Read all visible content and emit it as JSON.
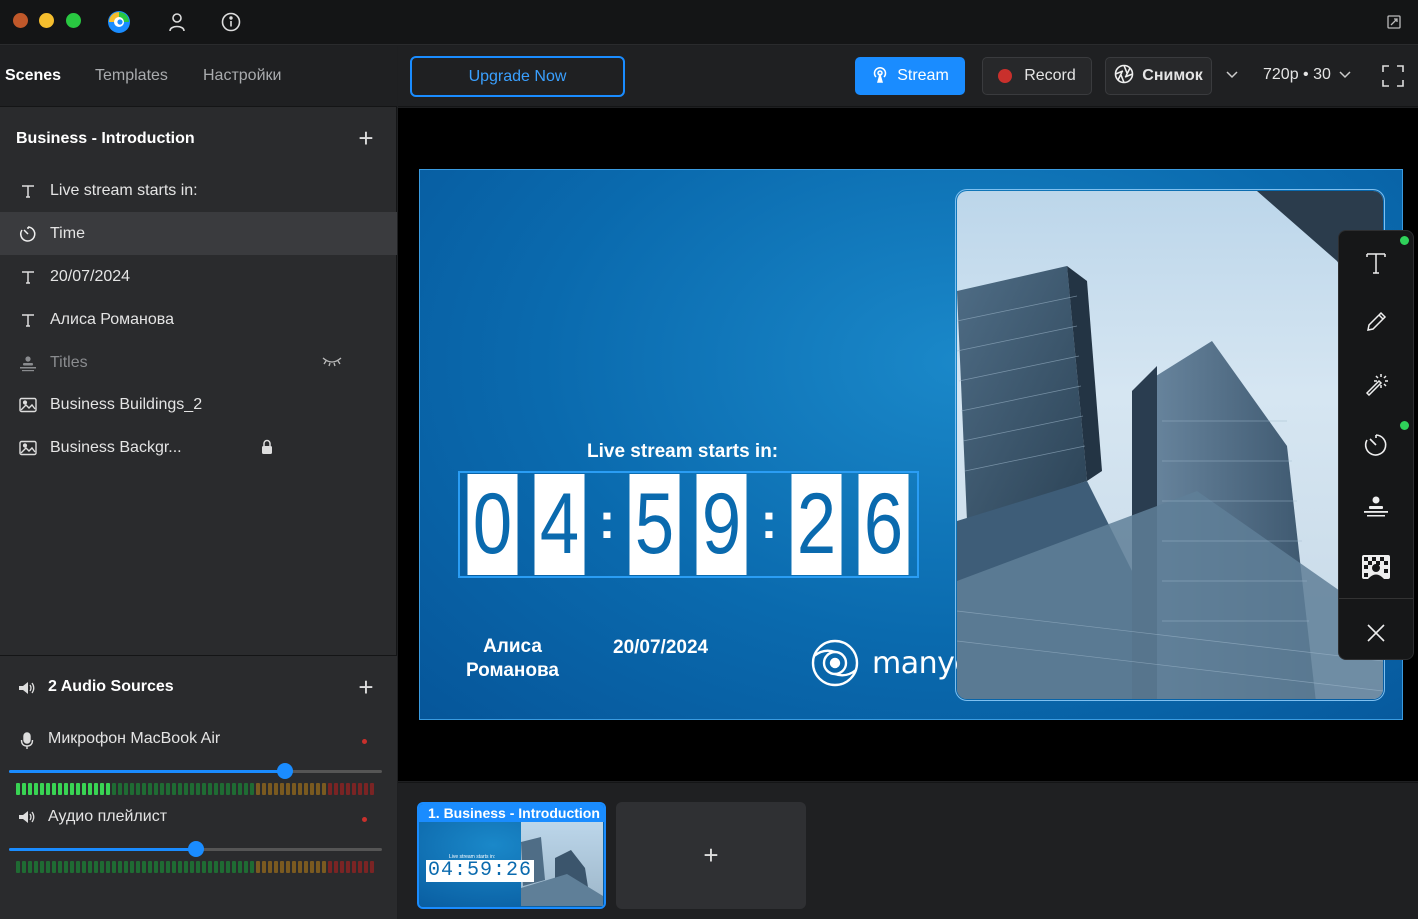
{
  "titlebar": {
    "icons": [
      "close-dot",
      "minimize-dot",
      "maximize-dot",
      "manycam-logo-icon",
      "user-icon",
      "info-icon",
      "window-restore-icon"
    ]
  },
  "left": {
    "tabs": [
      {
        "label": "Scenes",
        "active": true
      },
      {
        "label": "Templates",
        "active": false
      },
      {
        "label": "Настройки",
        "active": false
      }
    ],
    "scene_title": "Business - Introduction",
    "layers": [
      {
        "label": "Live stream starts in:",
        "icon": "text-icon",
        "selected": false,
        "hidden": false
      },
      {
        "label": "Time",
        "icon": "timer-icon",
        "selected": true,
        "hidden": false
      },
      {
        "label": "20/07/2024",
        "icon": "text-icon",
        "selected": false,
        "hidden": false
      },
      {
        "label": "Алиса Романова",
        "icon": "text-icon",
        "selected": false,
        "hidden": false
      },
      {
        "label": "Titles",
        "icon": "lower-third-icon",
        "selected": false,
        "hidden": true
      },
      {
        "label": "Business Buildings_2",
        "icon": "image-icon",
        "selected": false,
        "hidden": false
      },
      {
        "label": "Business Backgr...",
        "icon": "image-icon",
        "selected": false,
        "hidden": false,
        "locked": true
      }
    ],
    "audio": {
      "title": "2 Audio Sources",
      "sources": [
        {
          "label": "Микрофон MacBook Air",
          "icon": "microphone-icon",
          "volume_pct": 74,
          "level_bars": 16
        },
        {
          "label": "Аудио плейлист",
          "icon": "speaker-icon",
          "volume_pct": 50,
          "level_bars": 0
        }
      ]
    }
  },
  "toolbar": {
    "upgrade_label": "Upgrade Now",
    "stream_label": "Stream",
    "record_label": "Record",
    "snapshot_label": "Снимок",
    "resolution_label": "720p • 30"
  },
  "preview": {
    "caption": "Live stream starts in:",
    "timer_digits": [
      "0",
      "4",
      "5",
      "9",
      "2",
      "6"
    ],
    "name": "Алиса Романова",
    "date": "20/07/2024",
    "logo_text": "manycam"
  },
  "rail": {
    "tools": [
      "text-tool-icon",
      "draw-tool-icon",
      "effects-wand-icon",
      "timer-tool-icon",
      "lower-third-tool-icon",
      "chroma-key-icon",
      "close-icon"
    ]
  },
  "scenes_strip": {
    "scenes": [
      {
        "label": "1. Business - Introduction",
        "mini_caption": "Live stream starts in:",
        "mini_timer": "04:59:26"
      }
    ],
    "add_label": "+"
  },
  "colors": {
    "accent": "#1a8cff",
    "preview_bg": "#0a6aae",
    "panel": "#2a2b2d",
    "toolbar": "#1f2022",
    "active_green": "#2fd15a",
    "record_red": "#c9302c"
  }
}
